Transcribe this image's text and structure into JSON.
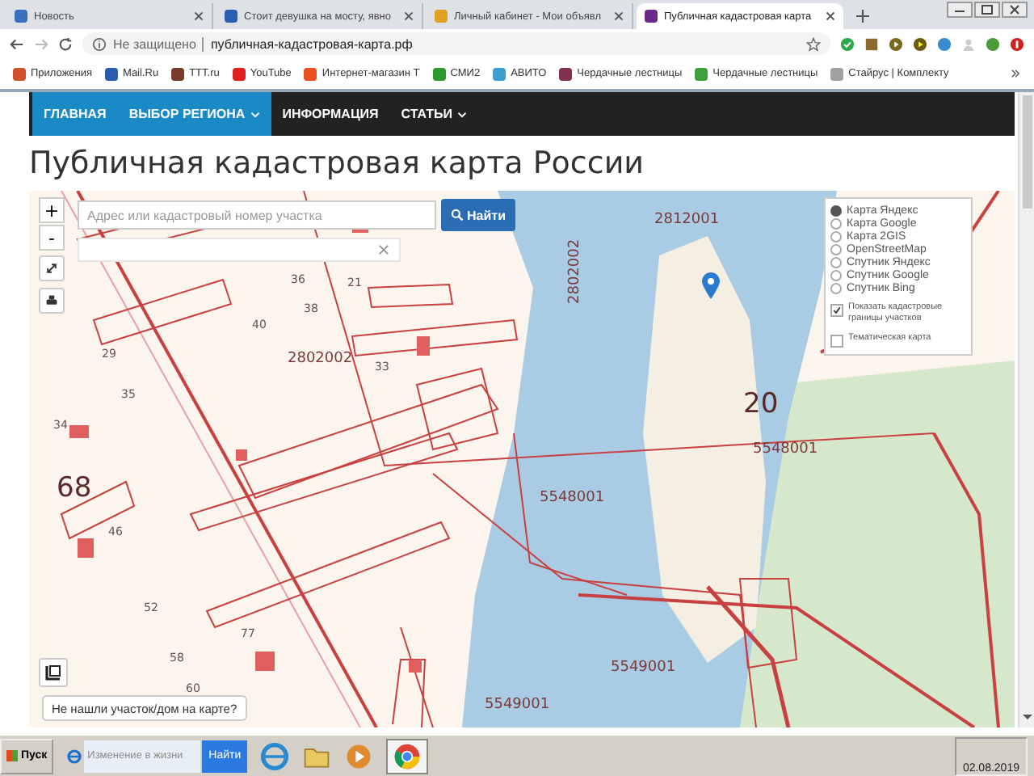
{
  "browser": {
    "tabs": [
      {
        "title": "Новость",
        "selected": false
      },
      {
        "title": "Стоит девушка на мосту, явно",
        "selected": false
      },
      {
        "title": "Личный кабинет - Мои объявл",
        "selected": false
      },
      {
        "title": "Публичная кадастровая карта",
        "selected": true
      }
    ],
    "security": "Не защищено",
    "url": "публичная-кадастровая-карта.рф",
    "bookmarks": [
      "Приложения",
      "Mail.Ru",
      "TTT.ru",
      "YouTube",
      "Интернет-магазин Т",
      "СМИ2",
      "АВИТО",
      "Чердачные лестницы",
      "Чердачные лестницы",
      "Стайрус | Комплекту"
    ]
  },
  "nav": [
    {
      "label": "ГЛАВНАЯ",
      "highlighted": true,
      "dropdown": false
    },
    {
      "label": "ВЫБОР РЕГИОНА",
      "highlighted": true,
      "dropdown": true
    },
    {
      "label": "ИНФОРМАЦИЯ",
      "highlighted": false,
      "dropdown": false
    },
    {
      "label": "СТАТЬИ",
      "highlighted": false,
      "dropdown": true
    }
  ],
  "title": "Публичная кадастровая карта России",
  "map": {
    "zoom_in": "+",
    "zoom_out": "-",
    "search": {
      "placeholder": "Адрес или кадастровый номер участка",
      "button": "Найти"
    },
    "layers": [
      {
        "label": "Карта Яндекс",
        "selected": true
      },
      {
        "label": "Карта Google",
        "selected": false
      },
      {
        "label": "Карта 2GIS",
        "selected": false
      },
      {
        "label": "OpenStreetMap",
        "selected": false
      },
      {
        "label": "Спутник Яндекс",
        "selected": false
      },
      {
        "label": "Спутник Google",
        "selected": false
      },
      {
        "label": "Спутник Bing",
        "selected": false
      }
    ],
    "options": [
      {
        "label": "Показать кадастровые границы участков",
        "checked": true
      },
      {
        "label": "Тематическая карта",
        "checked": false
      }
    ],
    "labels": [
      {
        "text": "2812001",
        "kind": "block"
      },
      {
        "text": "2802002",
        "kind": "block"
      },
      {
        "text": "2802002",
        "kind": "vertical"
      },
      {
        "text": "20",
        "kind": "quarter"
      },
      {
        "text": "5548001",
        "kind": "block"
      },
      {
        "text": "5548001",
        "kind": "block"
      },
      {
        "text": "68",
        "kind": "quarter"
      },
      {
        "text": "5549001",
        "kind": "block"
      },
      {
        "text": "5549001",
        "kind": "block"
      },
      {
        "text": "36",
        "kind": "parcel"
      },
      {
        "text": "21",
        "kind": "parcel"
      },
      {
        "text": "38",
        "kind": "parcel"
      },
      {
        "text": "40",
        "kind": "parcel"
      },
      {
        "text": "33",
        "kind": "parcel"
      },
      {
        "text": "29",
        "kind": "parcel"
      },
      {
        "text": "35",
        "kind": "parcel"
      },
      {
        "text": "34",
        "kind": "parcel"
      },
      {
        "text": "46",
        "kind": "parcel"
      },
      {
        "text": "52",
        "kind": "parcel"
      },
      {
        "text": "77",
        "kind": "parcel"
      },
      {
        "text": "58",
        "kind": "parcel"
      },
      {
        "text": "60",
        "kind": "parcel"
      }
    ],
    "help_button": "Не нашли участок/дом на карте?"
  },
  "taskbar": {
    "start": "Пуск",
    "search_placeholder": "Изменение в жизни",
    "search_button": "Найти",
    "date": "02.08.2019"
  }
}
